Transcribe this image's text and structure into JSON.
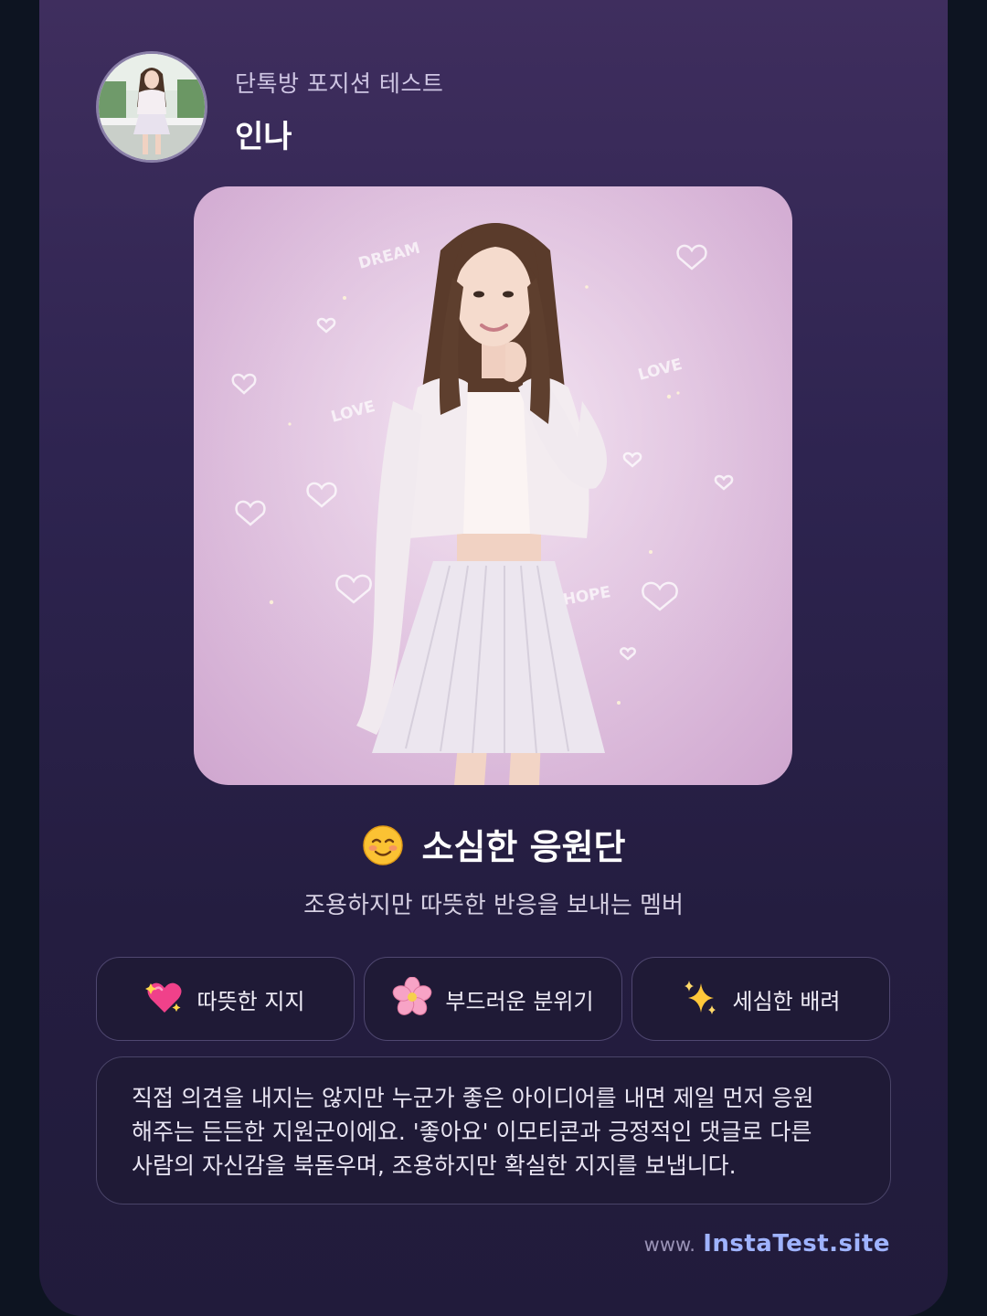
{
  "header": {
    "subtitle": "단톡방 포지션 테스트",
    "name": "인나"
  },
  "hero": {
    "decor_words": [
      "DREAM",
      "LOVE",
      "LOVE",
      "HOPE"
    ]
  },
  "result": {
    "emoji": "☺️",
    "title": "소심한 응원단",
    "subtitle": "조용하지만 따뜻한 반응을 보내는 멤버"
  },
  "tags": [
    {
      "icon": "sparkling-heart-icon",
      "label": "따뜻한 지지"
    },
    {
      "icon": "cherry-blossom-icon",
      "label": "부드러운 분위기"
    },
    {
      "icon": "sparkles-icon",
      "label": "세심한 배려"
    }
  ],
  "description": {
    "lines": [
      "직접 의견을 내지는 않지만 누군가 좋은 아이디어를 내면 제일 먼저 응원",
      "해주는 든든한 지원군이에요. '좋아요' 이모티콘과 긍정적인 댓글로 다른",
      "사람의 자신감을 북돋우며, 조용하지만 확실한 지지를 보냅니다."
    ]
  },
  "footer": {
    "prefix": "www.",
    "site": "InstaTest.site"
  },
  "colors": {
    "background": "#0d1421",
    "card_top": "#3f2e5e",
    "card_bottom": "#211b3b",
    "accent_link": "#9fb3ff",
    "hero_bg": "#e2c6e1"
  }
}
